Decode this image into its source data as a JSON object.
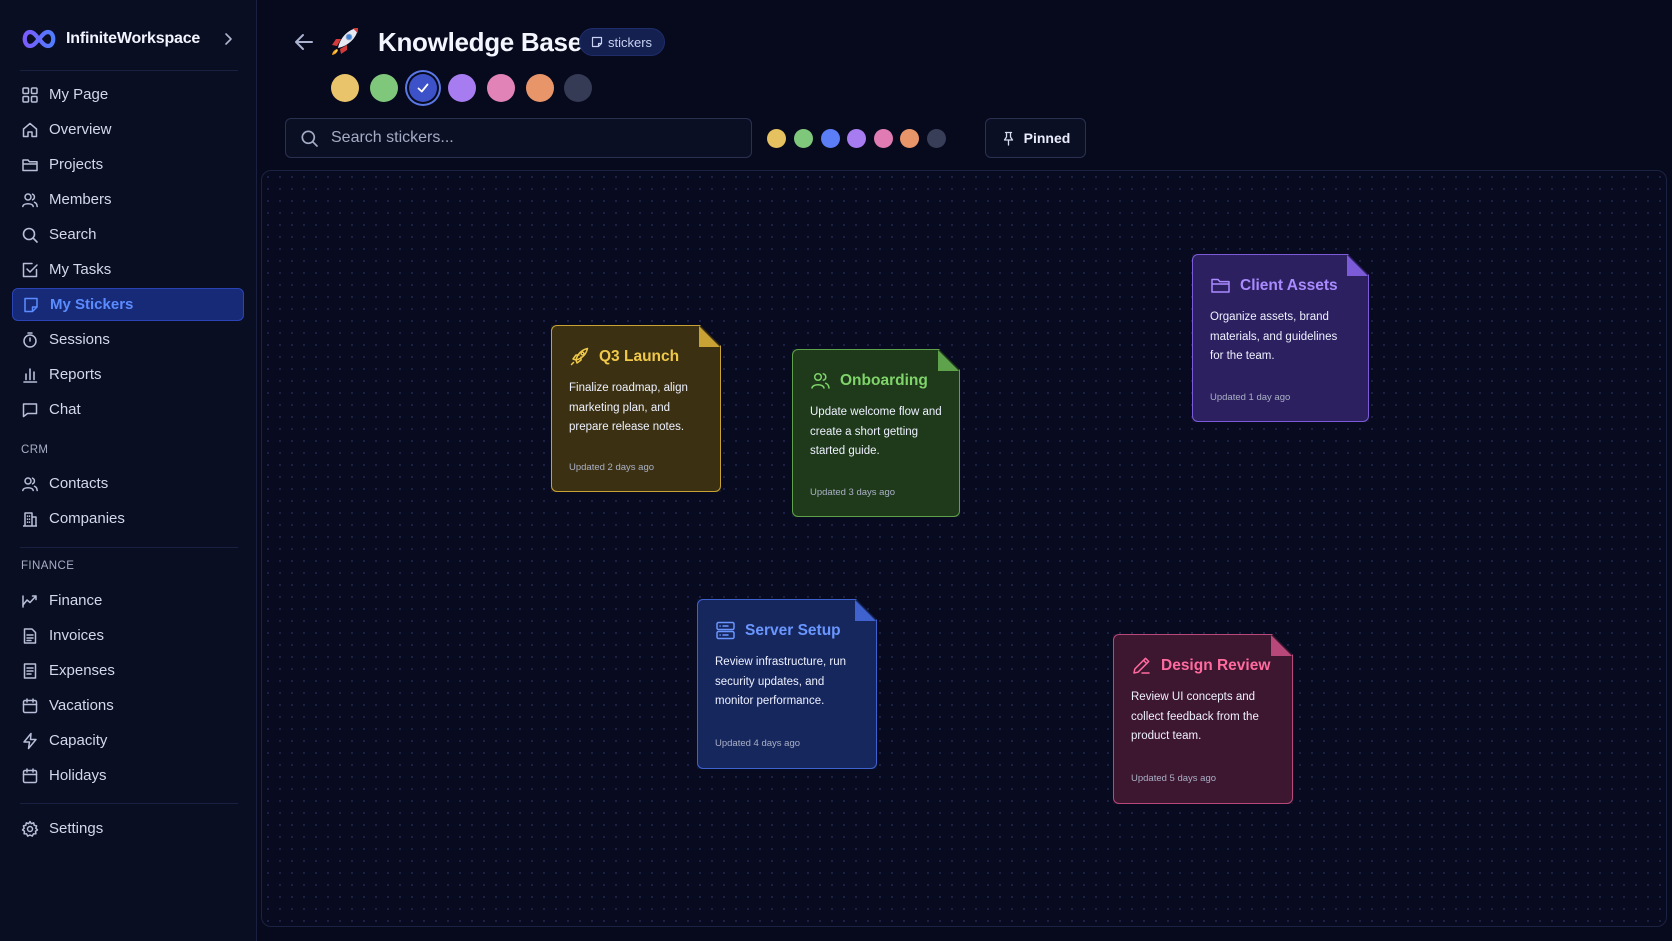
{
  "app": {
    "name": "InfiniteWorkspace"
  },
  "sidebar": {
    "items": [
      {
        "label": "My Page",
        "icon": "grid-icon"
      },
      {
        "label": "Overview",
        "icon": "home-icon"
      },
      {
        "label": "Projects",
        "icon": "folder-icon"
      },
      {
        "label": "Members",
        "icon": "users-icon"
      },
      {
        "label": "Search",
        "icon": "search-icon"
      },
      {
        "label": "My Tasks",
        "icon": "checkbox-icon"
      },
      {
        "label": "My Stickers",
        "icon": "sticker-icon",
        "active": true
      },
      {
        "label": "Sessions",
        "icon": "timer-icon"
      },
      {
        "label": "Reports",
        "icon": "bar-chart-icon"
      },
      {
        "label": "Chat",
        "icon": "chat-icon"
      }
    ],
    "crm": {
      "label": "CRM",
      "items": [
        {
          "label": "Contacts",
          "icon": "contacts-icon"
        },
        {
          "label": "Companies",
          "icon": "building-icon"
        }
      ]
    },
    "finance": {
      "label": "FINANCE",
      "items": [
        {
          "label": "Finance",
          "icon": "finance-icon"
        },
        {
          "label": "Invoices",
          "icon": "invoice-icon"
        },
        {
          "label": "Expenses",
          "icon": "receipt-icon"
        },
        {
          "label": "Vacations",
          "icon": "calendar-icon"
        },
        {
          "label": "Capacity",
          "icon": "lightning-icon"
        },
        {
          "label": "Holidays",
          "icon": "calendar-icon"
        }
      ]
    },
    "settings": {
      "label": "Settings",
      "icon": "gear-icon"
    }
  },
  "header": {
    "title": "Knowledge Base",
    "emoji": "rocket-icon",
    "tag": "stickers",
    "swatches": [
      "#e9c46a",
      "#7fc77b",
      "#3d52c8",
      "#a77cf0",
      "#e283b8",
      "#e8956a",
      "#353a55"
    ],
    "selected_swatch": 2
  },
  "toolbar": {
    "search_placeholder": "Search stickers...",
    "filter_colors": [
      "#e5c160",
      "#7fc77b",
      "#5b7df5",
      "#a77cf0",
      "#e07bb4",
      "#e8956a",
      "#393e58"
    ],
    "pinned_label": "Pinned"
  },
  "stickers": [
    {
      "title": "Q3 Launch",
      "icon": "rocket-icon",
      "description": "Finalize roadmap, align marketing plan, and prepare release notes.",
      "updated": "Updated 2 days ago",
      "accent": "#f0c84a",
      "background": "#3b3112",
      "border": "#c9a236"
    },
    {
      "title": "Onboarding",
      "icon": "users-icon",
      "description": "Update welcome flow and create a short getting started guide.",
      "updated": "Updated 3 days ago",
      "accent": "#7fd46a",
      "background": "#1f3a1b",
      "border": "#5ea24c"
    },
    {
      "title": "Client Assets",
      "icon": "folder-icon",
      "description": "Organize assets, brand materials, and guidelines for the team.",
      "updated": "Updated 1 day ago",
      "accent": "#a98bff",
      "background": "#2c2060",
      "border": "#7b5bd8"
    },
    {
      "title": "Server Setup",
      "icon": "server-icon",
      "description": "Review infrastructure, run security updates, and monitor performance.",
      "updated": "Updated 4 days ago",
      "accent": "#6a96ff",
      "background": "#16275e",
      "border": "#3f62cf"
    },
    {
      "title": "Design Review",
      "icon": "pencil-icon",
      "description": "Review UI concepts and collect feedback from the product team.",
      "updated": "Updated 5 days ago",
      "accent": "#ff6b9e",
      "background": "#3d1630",
      "border": "#b8487a"
    }
  ]
}
